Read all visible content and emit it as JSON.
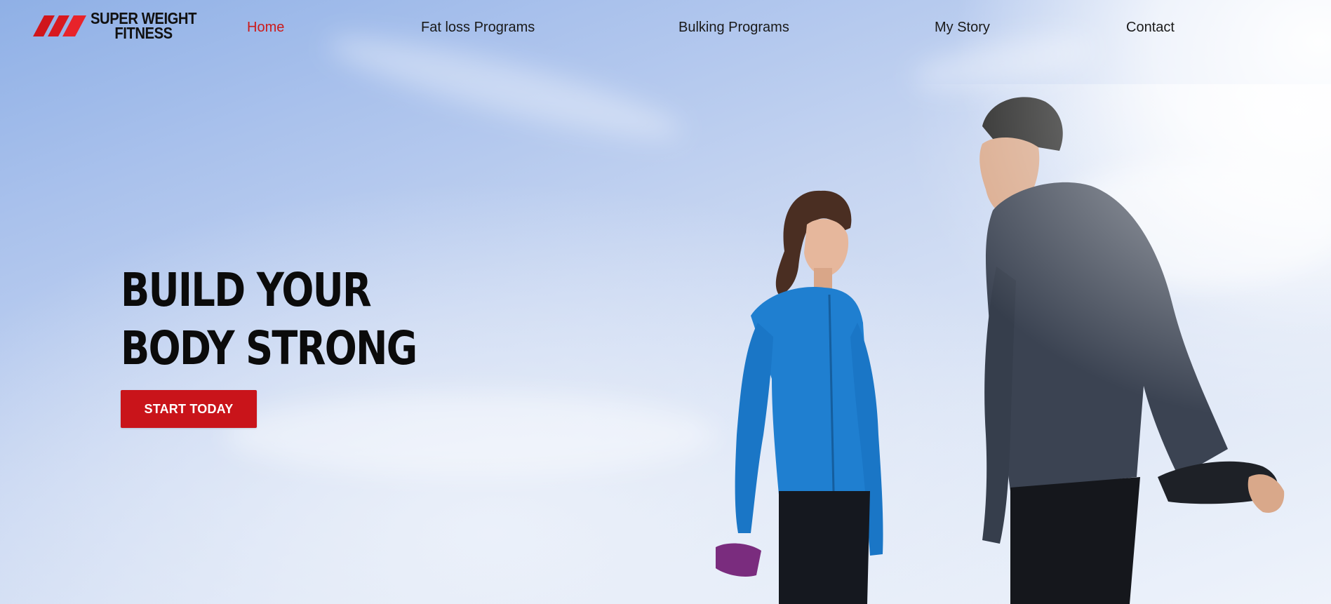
{
  "brand": {
    "name_line1": "SUPER WEIGHT",
    "name_line2": "FITNESS",
    "accent_color": "#cc1a1a"
  },
  "nav": {
    "items": [
      {
        "label": "Home",
        "active": true
      },
      {
        "label": "Fat loss Programs",
        "active": false
      },
      {
        "label": "Bulking Programs",
        "active": false
      },
      {
        "label": "My Story",
        "active": false
      },
      {
        "label": "Contact",
        "active": false
      }
    ]
  },
  "hero": {
    "title_line1": "BUILD YOUR",
    "title_line2": "BODY STRONG",
    "cta_label": "START TODAY",
    "cta_color": "#c9141a"
  }
}
